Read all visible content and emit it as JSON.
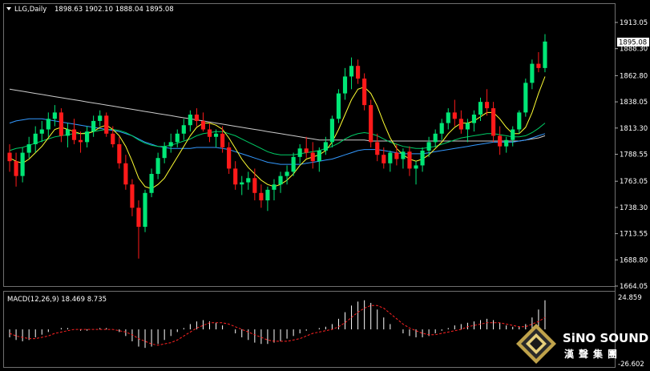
{
  "header": {
    "symbol_label": "LLG,Daily",
    "ohlc_label": "1898.63 1902.10 1888.04 1895.08"
  },
  "price_axis": {
    "ticks": [
      "1913.05",
      "1888.30",
      "1862.80",
      "1838.05",
      "1813.30",
      "1788.55",
      "1763.05",
      "1738.30",
      "1713.55",
      "1688.80",
      "1664.05"
    ],
    "current_price_label": "1895.08"
  },
  "macd": {
    "label": "MACD(12,26,9) 18.469 8.735",
    "ticks": [
      "24.859",
      "-26.602"
    ]
  },
  "logo": {
    "english": "SiNO SOUND",
    "chinese": "漢聲集團"
  },
  "colors": {
    "background": "#000000",
    "bull": "#00e676",
    "bear": "#ff1a1a",
    "ma_fast": "#ffff33",
    "ma_mid": "#00cc66",
    "ma_blue": "#3399ff",
    "ma_slow": "#cccccc",
    "macd_hist": "#ffffff",
    "macd_signal": "#ff2222"
  },
  "chart_data": {
    "type": "candlestick",
    "price_range": [
      1664.05,
      1913.05
    ],
    "macd_range": [
      -26.602,
      24.859
    ],
    "candles": [
      [
        1790,
        1798,
        1772,
        1782
      ],
      [
        1782,
        1790,
        1758,
        1768
      ],
      [
        1768,
        1795,
        1762,
        1790
      ],
      [
        1790,
        1805,
        1785,
        1798
      ],
      [
        1798,
        1815,
        1790,
        1808
      ],
      [
        1808,
        1820,
        1800,
        1812
      ],
      [
        1812,
        1828,
        1805,
        1822
      ],
      [
        1822,
        1835,
        1815,
        1828
      ],
      [
        1828,
        1832,
        1800,
        1806
      ],
      [
        1806,
        1818,
        1795,
        1812
      ],
      [
        1812,
        1822,
        1798,
        1802
      ],
      [
        1802,
        1810,
        1790,
        1800
      ],
      [
        1800,
        1815,
        1795,
        1810
      ],
      [
        1810,
        1825,
        1805,
        1820
      ],
      [
        1820,
        1830,
        1815,
        1825
      ],
      [
        1825,
        1828,
        1805,
        1808
      ],
      [
        1808,
        1815,
        1795,
        1798
      ],
      [
        1798,
        1805,
        1775,
        1780
      ],
      [
        1780,
        1788,
        1755,
        1760
      ],
      [
        1760,
        1765,
        1730,
        1738
      ],
      [
        1738,
        1745,
        1690,
        1720
      ],
      [
        1720,
        1755,
        1715,
        1752
      ],
      [
        1752,
        1775,
        1748,
        1770
      ],
      [
        1770,
        1790,
        1765,
        1785
      ],
      [
        1785,
        1800,
        1780,
        1796
      ],
      [
        1796,
        1808,
        1790,
        1800
      ],
      [
        1800,
        1812,
        1795,
        1808
      ],
      [
        1808,
        1822,
        1802,
        1816
      ],
      [
        1816,
        1830,
        1810,
        1826
      ],
      [
        1826,
        1832,
        1815,
        1820
      ],
      [
        1820,
        1828,
        1810,
        1812
      ],
      [
        1812,
        1818,
        1800,
        1805
      ],
      [
        1805,
        1812,
        1795,
        1808
      ],
      [
        1808,
        1815,
        1790,
        1795
      ],
      [
        1795,
        1800,
        1770,
        1775
      ],
      [
        1775,
        1782,
        1755,
        1760
      ],
      [
        1760,
        1768,
        1750,
        1762
      ],
      [
        1762,
        1772,
        1755,
        1766
      ],
      [
        1766,
        1775,
        1745,
        1752
      ],
      [
        1752,
        1760,
        1738,
        1745
      ],
      [
        1745,
        1758,
        1735,
        1755
      ],
      [
        1755,
        1765,
        1745,
        1760
      ],
      [
        1760,
        1772,
        1752,
        1768
      ],
      [
        1768,
        1778,
        1760,
        1772
      ],
      [
        1772,
        1790,
        1768,
        1786
      ],
      [
        1786,
        1798,
        1780,
        1794
      ],
      [
        1794,
        1805,
        1785,
        1790
      ],
      [
        1790,
        1800,
        1775,
        1782
      ],
      [
        1782,
        1795,
        1772,
        1792
      ],
      [
        1792,
        1805,
        1788,
        1800
      ],
      [
        1800,
        1825,
        1795,
        1822
      ],
      [
        1822,
        1850,
        1818,
        1846
      ],
      [
        1846,
        1870,
        1840,
        1862
      ],
      [
        1862,
        1880,
        1850,
        1872
      ],
      [
        1872,
        1878,
        1855,
        1860
      ],
      [
        1860,
        1865,
        1830,
        1835
      ],
      [
        1835,
        1840,
        1795,
        1800
      ],
      [
        1800,
        1808,
        1782,
        1788
      ],
      [
        1788,
        1795,
        1775,
        1780
      ],
      [
        1780,
        1792,
        1772,
        1790
      ],
      [
        1790,
        1798,
        1778,
        1784
      ],
      [
        1784,
        1794,
        1775,
        1791
      ],
      [
        1791,
        1796,
        1768,
        1775
      ],
      [
        1775,
        1782,
        1760,
        1778
      ],
      [
        1778,
        1795,
        1772,
        1792
      ],
      [
        1792,
        1805,
        1786,
        1800
      ],
      [
        1800,
        1812,
        1795,
        1808
      ],
      [
        1808,
        1822,
        1802,
        1818
      ],
      [
        1818,
        1832,
        1812,
        1828
      ],
      [
        1828,
        1840,
        1815,
        1822
      ],
      [
        1822,
        1830,
        1808,
        1812
      ],
      [
        1812,
        1822,
        1800,
        1818
      ],
      [
        1818,
        1830,
        1810,
        1826
      ],
      [
        1826,
        1842,
        1820,
        1838
      ],
      [
        1838,
        1850,
        1825,
        1832
      ],
      [
        1832,
        1838,
        1800,
        1806
      ],
      [
        1806,
        1815,
        1788,
        1796
      ],
      [
        1796,
        1805,
        1790,
        1802
      ],
      [
        1802,
        1815,
        1796,
        1812
      ],
      [
        1812,
        1830,
        1808,
        1828
      ],
      [
        1828,
        1860,
        1824,
        1856
      ],
      [
        1856,
        1878,
        1850,
        1874
      ],
      [
        1874,
        1885,
        1866,
        1870
      ],
      [
        1870,
        1902,
        1866,
        1895
      ]
    ],
    "ma_fast": [
      1785,
      1782,
      1780,
      1784,
      1790,
      1796,
      1804,
      1812,
      1814,
      1812,
      1810,
      1808,
      1808,
      1810,
      1814,
      1816,
      1812,
      1806,
      1796,
      1782,
      1766,
      1758,
      1756,
      1760,
      1766,
      1776,
      1786,
      1796,
      1806,
      1814,
      1818,
      1818,
      1816,
      1812,
      1804,
      1794,
      1784,
      1776,
      1770,
      1764,
      1760,
      1758,
      1760,
      1764,
      1770,
      1778,
      1784,
      1786,
      1788,
      1792,
      1800,
      1812,
      1826,
      1840,
      1850,
      1852,
      1846,
      1834,
      1818,
      1804,
      1794,
      1788,
      1784,
      1782,
      1784,
      1788,
      1794,
      1800,
      1808,
      1814,
      1818,
      1818,
      1820,
      1824,
      1828,
      1828,
      1822,
      1814,
      1808,
      1808,
      1814,
      1828,
      1846,
      1862
    ],
    "ma_mid": [
      1792,
      1794,
      1795,
      1797,
      1799,
      1801,
      1803,
      1805,
      1806,
      1807,
      1808,
      1808,
      1809,
      1810,
      1811,
      1812,
      1812,
      1811,
      1809,
      1806,
      1802,
      1799,
      1797,
      1796,
      1796,
      1797,
      1799,
      1801,
      1803,
      1806,
      1808,
      1809,
      1810,
      1810,
      1808,
      1806,
      1803,
      1800,
      1797,
      1794,
      1791,
      1789,
      1788,
      1788,
      1788,
      1789,
      1790,
      1791,
      1792,
      1794,
      1796,
      1799,
      1803,
      1806,
      1808,
      1809,
      1808,
      1806,
      1803,
      1800,
      1798,
      1796,
      1795,
      1794,
      1794,
      1795,
      1796,
      1798,
      1800,
      1802,
      1804,
      1805,
      1806,
      1807,
      1808,
      1808,
      1807,
      1806,
      1805,
      1805,
      1806,
      1809,
      1813,
      1818
    ],
    "ma_blue": [
      1818,
      1820,
      1821,
      1822,
      1822,
      1822,
      1821,
      1820,
      1819,
      1818,
      1817,
      1816,
      1815,
      1814,
      1813,
      1812,
      1811,
      1810,
      1808,
      1806,
      1803,
      1800,
      1798,
      1796,
      1795,
      1794,
      1794,
      1794,
      1794,
      1795,
      1795,
      1795,
      1795,
      1794,
      1793,
      1791,
      1789,
      1787,
      1785,
      1783,
      1781,
      1780,
      1779,
      1779,
      1779,
      1779,
      1780,
      1781,
      1782,
      1783,
      1784,
      1786,
      1788,
      1790,
      1792,
      1793,
      1793,
      1793,
      1792,
      1791,
      1790,
      1789,
      1789,
      1789,
      1789,
      1790,
      1791,
      1792,
      1793,
      1794,
      1795,
      1796,
      1797,
      1798,
      1799,
      1800,
      1800,
      1800,
      1800,
      1801,
      1802,
      1804,
      1806,
      1808
    ],
    "ma_slow": [
      1850,
      1849,
      1848,
      1847,
      1846,
      1845,
      1844,
      1843,
      1842,
      1841,
      1840,
      1839,
      1838,
      1837,
      1836,
      1835,
      1834,
      1833,
      1832,
      1831,
      1830,
      1829,
      1828,
      1827,
      1826,
      1825,
      1824,
      1823,
      1822,
      1821,
      1820,
      1819,
      1818,
      1817,
      1816,
      1815,
      1814,
      1813,
      1812,
      1811,
      1810,
      1809,
      1808,
      1807,
      1806,
      1805,
      1804,
      1803,
      1802,
      1802,
      1802,
      1802,
      1802,
      1802,
      1802,
      1802,
      1801,
      1801,
      1801,
      1801,
      1801,
      1801,
      1801,
      1801,
      1801,
      1801,
      1801,
      1801,
      1801,
      1801,
      1801,
      1801,
      1801,
      1801,
      1801,
      1801,
      1801,
      1801,
      1801,
      1801,
      1802,
      1803,
      1804,
      1806
    ],
    "macd_hist": [
      -6,
      -8,
      -9,
      -8,
      -6,
      -4,
      -2,
      0,
      1,
      1,
      0,
      -1,
      -1,
      0,
      1,
      1,
      0,
      -2,
      -5,
      -9,
      -13,
      -14,
      -13,
      -11,
      -8,
      -5,
      -2,
      1,
      4,
      6,
      7,
      6,
      5,
      3,
      0,
      -3,
      -6,
      -8,
      -10,
      -11,
      -11,
      -10,
      -9,
      -7,
      -5,
      -3,
      -1,
      0,
      1,
      2,
      4,
      8,
      13,
      18,
      21,
      22,
      20,
      15,
      9,
      4,
      0,
      -3,
      -5,
      -6,
      -6,
      -5,
      -3,
      -1,
      1,
      3,
      4,
      5,
      6,
      7,
      8,
      7,
      5,
      3,
      2,
      2,
      4,
      9,
      15,
      22
    ],
    "macd_signal": [
      -3,
      -5,
      -6,
      -7,
      -7,
      -6,
      -5,
      -3,
      -2,
      -1,
      0,
      0,
      0,
      0,
      0,
      0,
      0,
      -1,
      -2,
      -4,
      -7,
      -9,
      -11,
      -12,
      -11,
      -10,
      -8,
      -5,
      -2,
      1,
      3,
      5,
      5,
      5,
      4,
      2,
      0,
      -2,
      -4,
      -6,
      -8,
      -9,
      -9,
      -9,
      -8,
      -7,
      -5,
      -3,
      -2,
      -1,
      0,
      2,
      5,
      9,
      13,
      16,
      18,
      18,
      16,
      12,
      8,
      4,
      1,
      -1,
      -3,
      -4,
      -4,
      -3,
      -2,
      -1,
      0,
      2,
      3,
      4,
      5,
      5,
      5,
      4,
      3,
      2,
      2,
      4,
      6,
      9
    ]
  }
}
